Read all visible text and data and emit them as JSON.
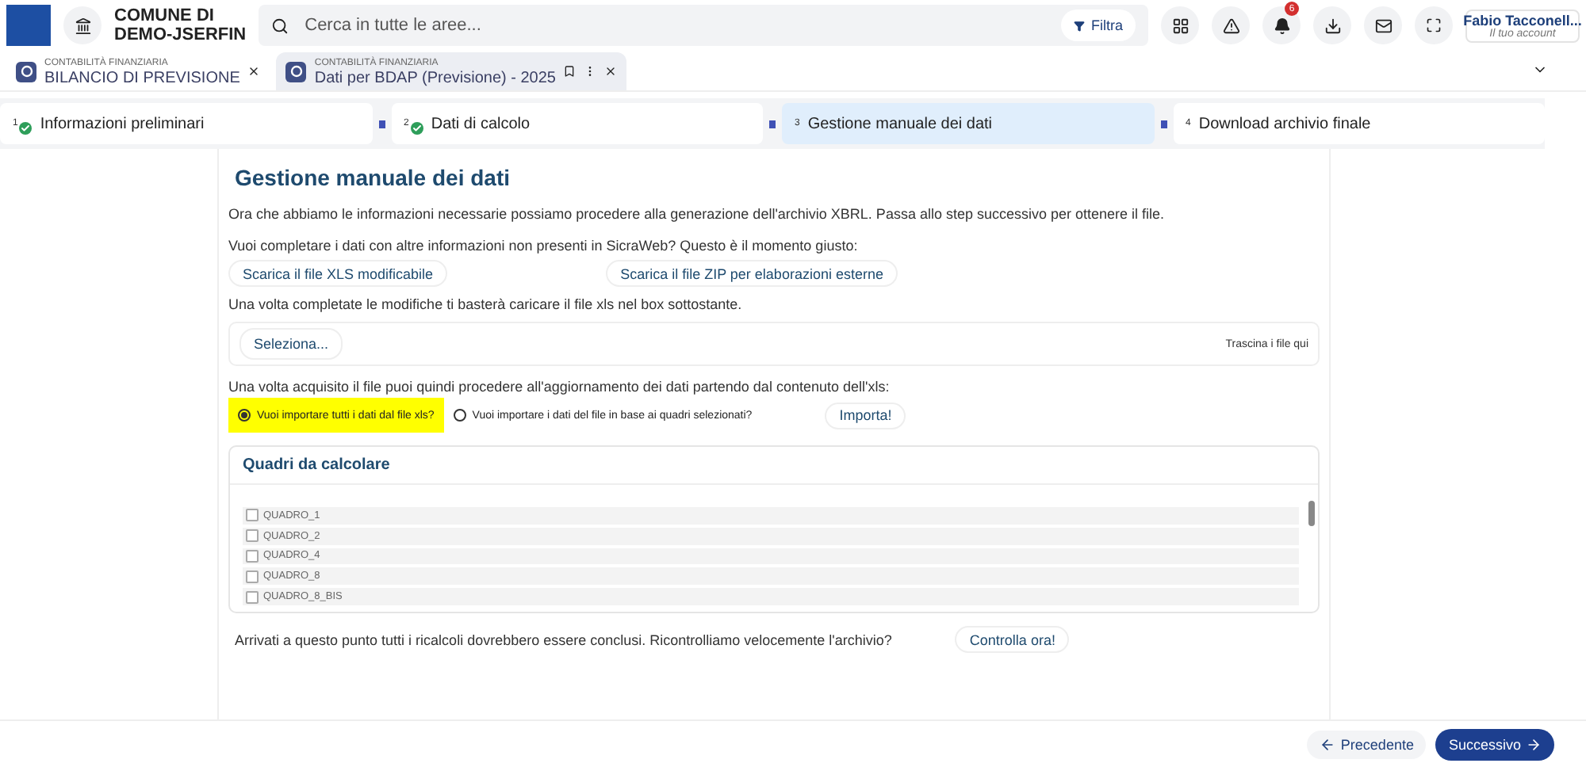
{
  "header": {
    "org_line1": "COMUNE DI",
    "org_line2": "DEMO-JSERFIN",
    "search": {
      "placeholder": "Cerca in tutte le aree..."
    },
    "filter_label": "Filtra",
    "notification_count": "6",
    "user_name": "Fabio Tacconell...",
    "user_sub": "Il tuo account"
  },
  "tabs": [
    {
      "section": "CONTABILITÀ FINANZIARIA",
      "title": "BILANCIO DI PREVISIONE",
      "selected": false
    },
    {
      "section": "CONTABILITÀ FINANZIARIA",
      "title": "Dati per BDAP (Previsione) - 2025",
      "selected": true
    }
  ],
  "steps": [
    {
      "number": "1",
      "label": "Informazioni preliminari",
      "done": true,
      "selected": false
    },
    {
      "number": "2",
      "label": "Dati di calcolo",
      "done": true,
      "selected": false
    },
    {
      "number": "3",
      "label": "Gestione manuale dei dati",
      "done": false,
      "selected": true
    },
    {
      "number": "4",
      "label": "Download archivio finale",
      "done": false,
      "selected": false
    }
  ],
  "content": {
    "title": "Gestione manuale dei dati",
    "intro": "Ora che abbiamo le informazioni necessarie possiamo procedere alla generazione dell'archivio XBRL. Passa allo step successivo per ottenere il file.",
    "question": "Vuoi completare i dati con altre informazioni non presenti in SicraWeb? Questo è il momento giusto:",
    "download_buttons": [
      "Scarica il file XLS modificabile",
      "Scarica il file ZIP per elaborazioni esterne"
    ],
    "upload_hint": "Una volta completate le modifiche ti basterà caricare il file xls nel box sottostante.",
    "select_button": "Seleziona...",
    "drop_hint": "Trascina i file qui",
    "import_hint": "Una volta acquisito il file puoi quindi procedere all'aggiornamento dei dati partendo dal contenuto dell'xls:",
    "import_options": [
      {
        "label": "Vuoi importare tutti i dati dal file xls?",
        "selected": true
      },
      {
        "label": "Vuoi importare i dati del file in base ai quadri selezionati?",
        "selected": false
      }
    ],
    "import_button": "Importa!",
    "quadri_title": "Quadri da calcolare",
    "quadri": [
      {
        "label": "QUADRO_1",
        "checked": false
      },
      {
        "label": "QUADRO_2",
        "checked": false
      },
      {
        "label": "QUADRO_4",
        "checked": false
      },
      {
        "label": "QUADRO_8",
        "checked": false
      },
      {
        "label": "QUADRO_8_BIS",
        "checked": false
      }
    ],
    "check_hint": "Arrivati a questo punto tutti i ricalcoli dovrebbero essere conclusi. Ricontrolliamo velocemente l'archivio?",
    "check_button": "Controlla ora!"
  },
  "footer": {
    "prev": "Precedente",
    "next": "Successivo"
  }
}
